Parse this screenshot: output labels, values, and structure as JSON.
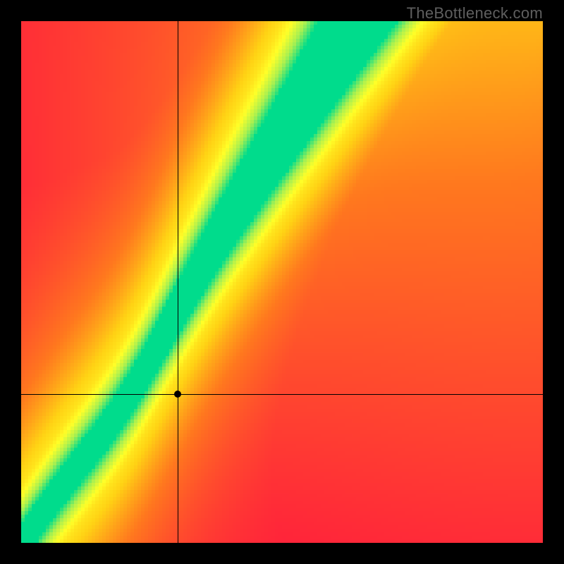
{
  "watermark": "TheBottleneck.com",
  "chart_data": {
    "type": "heatmap",
    "title": "",
    "xlabel": "",
    "ylabel": "",
    "xlim": [
      0,
      1
    ],
    "ylim": [
      0,
      1
    ],
    "grid_size": 148,
    "colormap": {
      "stops": [
        {
          "t": 0.0,
          "r": 255,
          "g": 18,
          "b": 64
        },
        {
          "t": 0.35,
          "r": 255,
          "g": 120,
          "b": 30
        },
        {
          "t": 0.55,
          "r": 255,
          "g": 210,
          "b": 20
        },
        {
          "t": 0.72,
          "r": 255,
          "g": 255,
          "b": 40
        },
        {
          "t": 0.86,
          "r": 170,
          "g": 240,
          "b": 80
        },
        {
          "t": 1.0,
          "r": 0,
          "g": 220,
          "b": 140
        }
      ],
      "note": "value 0..1 mapped red→orange→yellow→green like a bottleneck fit score"
    },
    "diagonal_band": {
      "origin_x": 0.0,
      "origin_y": 0.0,
      "slope": 1.55,
      "curve_pull_x": 0.2,
      "curve_pull_strength": 0.04,
      "core_half_width": 0.035,
      "soft_half_width": 0.11,
      "top_flare": 0.08,
      "note": "green optimum ridge; widens toward top-right (perfect CPU/GPU match line)"
    },
    "glow": {
      "corner_x": 1.0,
      "corner_y": 1.0,
      "radius": 1.25,
      "max_boost": 0.44,
      "note": "warmer yellow glow toward upper-right corner"
    },
    "marker": {
      "x": 0.3,
      "y": 0.285
    },
    "crosshair": {
      "x": 0.3,
      "y": 0.285
    }
  }
}
